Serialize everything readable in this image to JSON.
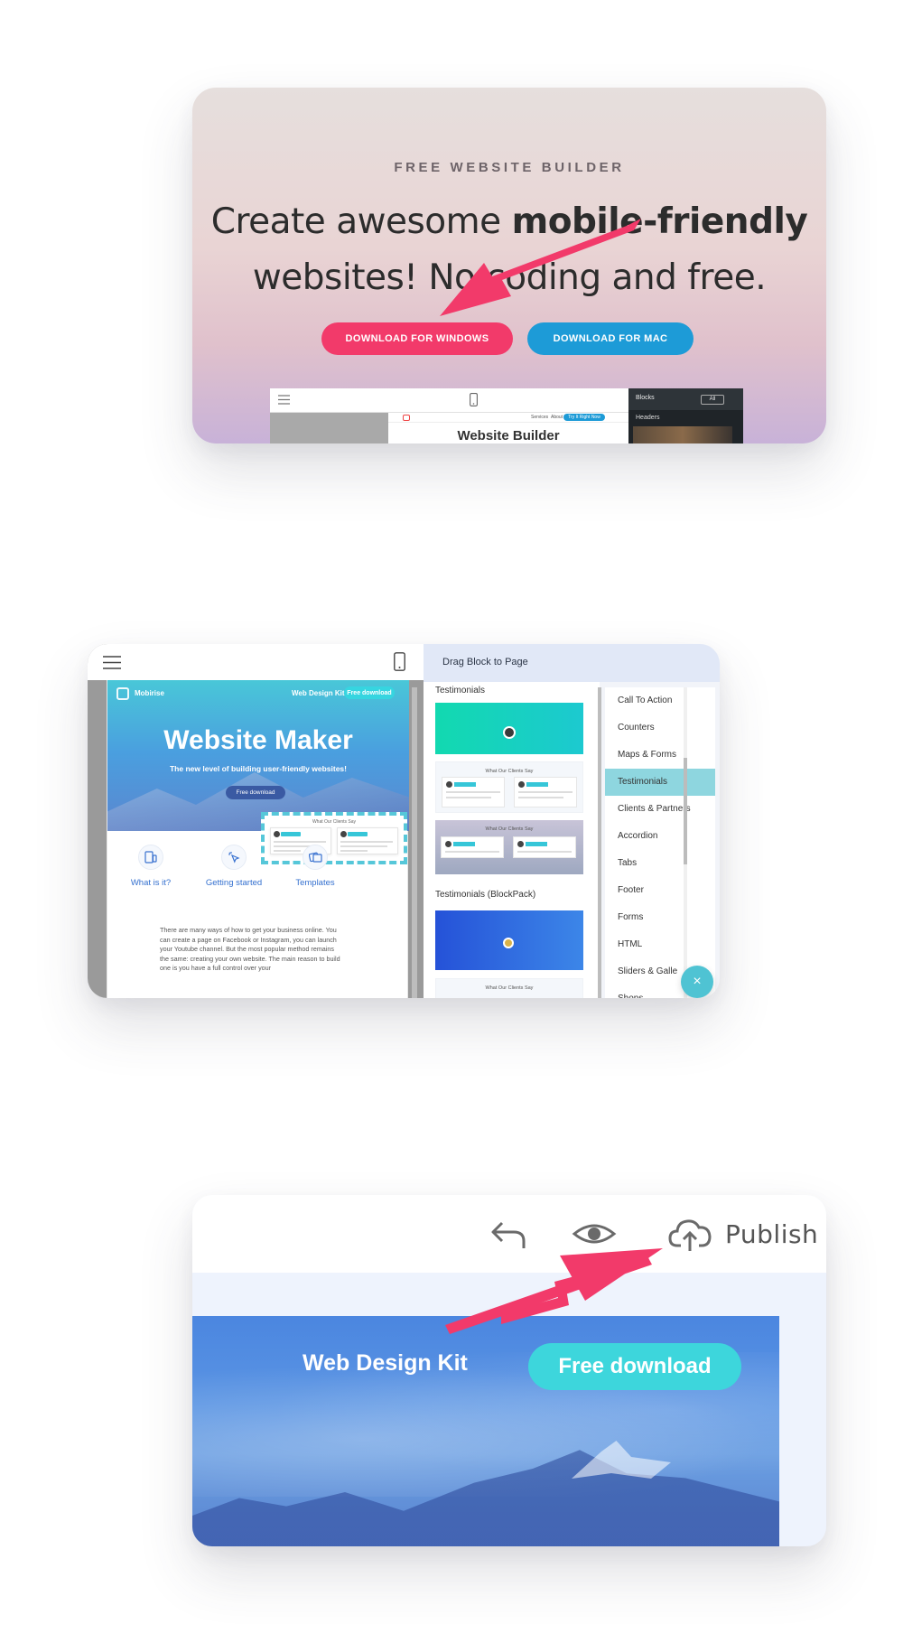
{
  "card1": {
    "eyebrow": "FREE WEBSITE BUILDER",
    "title_line1_regular": "Create awesome ",
    "title_line1_bold": "mobile-friendly",
    "title_line2": "websites! No coding and free.",
    "download_windows": "DOWNLOAD FOR WINDOWS",
    "download_mac": "DOWNLOAD FOR MAC",
    "app_preview": {
      "sidebar_label": "Blocks",
      "sidebar_filter": "All",
      "sidebar_section": "Headers",
      "site_nav_1": "Services",
      "site_nav_2": "About Us",
      "site_button": "Try It Right Now",
      "site_title": "Website Builder"
    }
  },
  "card2": {
    "panel_title": "Drag Block to Page",
    "site": {
      "brand": "Mobirise",
      "nav_kit": "Web Design Kit",
      "nav_free": "Free download",
      "title": "Website Maker",
      "subtitle": "The new level of building user-friendly websites!",
      "button": "Free download",
      "testimonial_title": "What Our Clients Say",
      "features": [
        {
          "label": "What is it?",
          "icon": "device-icon"
        },
        {
          "label": "Getting started",
          "icon": "cursor-click-icon"
        },
        {
          "label": "Templates",
          "icon": "images-icon"
        }
      ],
      "paragraph": "There are many ways of how to get your business online. You can create a page on Facebook or Instagram, you can launch your Youtube channel. But the most popular method remains the same: creating your own website. The main reason to build one is you have a full control over your"
    },
    "blocks": {
      "section1": "Testimonials",
      "section2": "Testimonials (BlockPack)",
      "thumb_title": "What Our Clients Say"
    },
    "categories": [
      {
        "label": "Call To Action",
        "active": false
      },
      {
        "label": "Counters",
        "active": false
      },
      {
        "label": "Maps & Forms",
        "active": false
      },
      {
        "label": "Testimonials",
        "active": true
      },
      {
        "label": "Clients & Partners",
        "active": false
      },
      {
        "label": "Accordion",
        "active": false
      },
      {
        "label": "Tabs",
        "active": false
      },
      {
        "label": "Footer",
        "active": false
      },
      {
        "label": "Forms",
        "active": false
      },
      {
        "label": "HTML",
        "active": false
      },
      {
        "label": "Sliders & Galle",
        "active": false
      },
      {
        "label": "Shops",
        "active": false
      }
    ],
    "close_symbol": "×"
  },
  "card3": {
    "publish": "Publish",
    "kit": "Web Design Kit",
    "free_download": "Free download",
    "icons": [
      "undo-icon",
      "eye-icon",
      "cloud-upload-icon"
    ]
  },
  "colors": {
    "pink_arrow": "#f23a6a",
    "windows_button": "#f23a6a",
    "mac_button": "#1d9bd7",
    "teal": "#3dd6dc"
  }
}
